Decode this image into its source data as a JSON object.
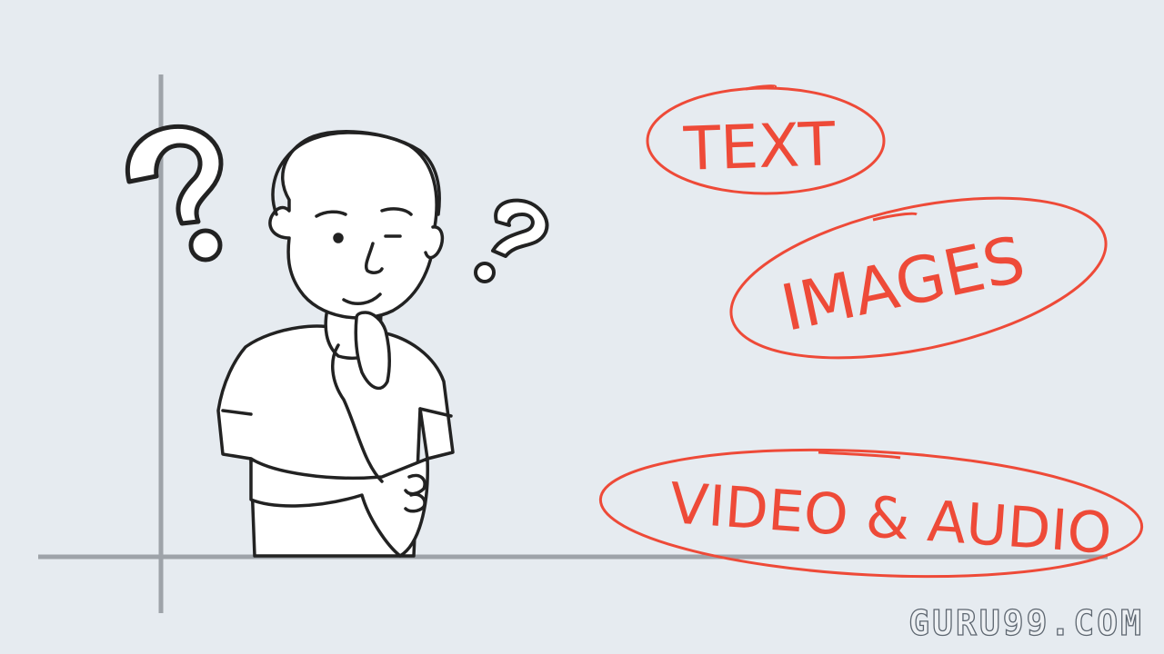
{
  "labels": {
    "text": "TEXT",
    "images": "IMAGES",
    "video_audio": "VIDEO & AUDIO"
  },
  "watermark": "GURU99.COM",
  "colors": {
    "background": "#e6ebf0",
    "accent": "#ee4a38",
    "ink": "#222222",
    "axis": "#9ea3a9"
  },
  "icons": [
    "question-mark-icon",
    "question-mark-icon",
    "thinking-person-illustration"
  ]
}
